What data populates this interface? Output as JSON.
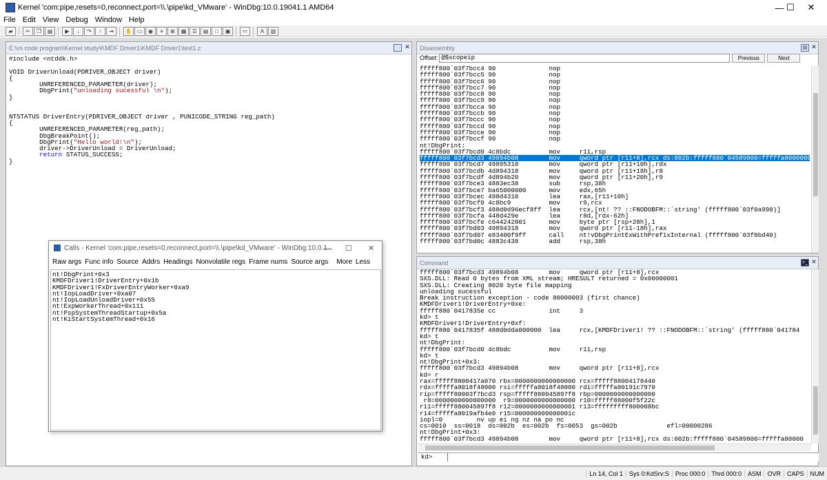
{
  "window": {
    "title": "Kernel 'com:pipe,resets=0,reconnect,port=\\\\.\\pipe\\kd_VMware' - WinDbg:10.0.19041.1 AMD64",
    "min_glyph": "—",
    "max_glyph": "☐",
    "close_glyph": "✕"
  },
  "menu": [
    "File",
    "Edit",
    "View",
    "Debug",
    "Window",
    "Help"
  ],
  "toolbar": [
    "open",
    "cut",
    "copy",
    "paste",
    "go",
    "step-into",
    "step-over",
    "step-out",
    "run-to-cursor",
    "break",
    "command",
    "watch",
    "locals",
    "registers",
    "memory",
    "call-stack",
    "disassembly",
    "scratch-pad",
    "processes",
    "source-mode",
    "font",
    "options"
  ],
  "source_pane": {
    "title": "E:\\vs code program\\Kernel study\\KMDF Driver1\\KMDF Driver1\\test1.c",
    "lines": [
      [
        {
          "t": "#include <ntddk.h>"
        }
      ],
      [
        {
          "t": ""
        }
      ],
      [
        {
          "t": "VOID DriverUnload(PDRIVER_OBJECT driver)"
        }
      ],
      [
        {
          "t": "{"
        }
      ],
      [
        {
          "t": "        UNREFERENCED_PARAMETER(driver);"
        }
      ],
      [
        {
          "t": "        DbgPrint("
        },
        {
          "t": "\"unloading sucessful \\n\"",
          "c": "str"
        },
        {
          "t": ");"
        }
      ],
      [
        {
          "t": "}"
        }
      ],
      [
        {
          "t": ""
        }
      ],
      [
        {
          "t": ""
        }
      ],
      [
        {
          "t": "NTSTATUS DriverEntry(PDRIVER_OBJECT driver , PUNICODE_STRING reg_path)"
        }
      ],
      [
        {
          "t": "{"
        }
      ],
      [
        {
          "t": "        UNREFERENCED_PARAMETER(reg_path);"
        }
      ],
      [
        {
          "t": "        DbgBreakPoint();"
        }
      ],
      [
        {
          "t": "        DbgPrint("
        },
        {
          "t": "\"Hello world!\\n\"",
          "c": "str"
        },
        {
          "t": ");"
        }
      ],
      [
        {
          "t": "        driver->DriverUnload = DriverUnload;"
        }
      ],
      [
        {
          "t": "        "
        },
        {
          "t": "return",
          "c": "kw"
        },
        {
          "t": " STATUS_SUCCESS;"
        }
      ],
      [
        {
          "t": "}"
        }
      ]
    ]
  },
  "disassembly_pane": {
    "title": "Disassembly",
    "offset_label": "Offset:",
    "offset_value": "@$scopeip",
    "previous_label": "Previous",
    "next_label": "Next",
    "highlight_index": 18,
    "lines": [
      "fffff800`03f7bcc4 90              nop",
      "fffff800`03f7bcc5 90              nop",
      "fffff800`03f7bcc6 90              nop",
      "fffff800`03f7bcc7 90              nop",
      "fffff800`03f7bcc8 90              nop",
      "fffff800`03f7bcc9 90              nop",
      "fffff800`03f7bcca 90              nop",
      "fffff800`03f7bccb 90              nop",
      "fffff800`03f7bccc 90              nop",
      "fffff800`03f7bccd 90              nop",
      "fffff800`03f7bcce 90              nop",
      "fffff800`03f7bccf 90              nop",
      "nt!DbgPrint:",
      "fffff800`03f7bcd0 4c8bdc          mov     r11,rsp",
      "fffff800`03f7bcd3 49894b08        mov     qword ptr [r11+8],rcx ds:002b:fffff880`04589800=fffffa8000000",
      "fffff800`03f7bcd7 49895310        mov     qword ptr [r11+10h],rdx",
      "fffff800`03f7bcdb 4d894318        mov     qword ptr [r11+18h],r8",
      "fffff800`03f7bcdf 4d894b20        mov     qword ptr [r11+20h],r9",
      "fffff800`03f7bce3 4883ec38        sub     rsp,38h",
      "fffff800`03f7bce7 ba65000000      mov     edx,65h",
      "fffff800`03f7bcec 498d4310        lea     rax,[r11+10h]",
      "fffff800`03f7bcf0 4c8bc9          mov     r9,rcx",
      "fffff800`03f7bcf3 488d0d96ecf8ff  lea     rcx,[nt! ?? ::FNODOBFM::`string' (fffff800`03f0a990)]",
      "fffff800`03f7bcfa 448d429e        lea     r8d,[rdx-62h]",
      "fffff800`03f7bcfe c644242801      mov     byte ptr [rsp+28h],1",
      "fffff800`03f7bd03 49894318        mov     qword ptr [r11-18h],rax",
      "fffff800`03f7bd07 e83400f9ff      call    nt!vDbgPrintExWithPrefixInternal (fffff800`03f0bd40)",
      "fffff800`03f7bd0c 4883c438        add     rsp,38h"
    ]
  },
  "command_pane": {
    "title": "Command",
    "prompt": "kd>",
    "lines": [
      "fffff800`03f7bcd3 49894b08        mov     qword ptr [r11+8],rcx",
      "SXS.DLL: Read 0 bytes from XML stream; HRESULT returned = 0x00000001",
      "SXS.DLL: Creating 8020 byte file mapping",
      "unloading sucessful",
      "Break instruction exception - code 80000003 (first chance)",
      "KMDFDriver1!DriverEntry+0xe:",
      "fffff880`0417835e cc              int     3",
      "kd> t",
      "KMDFDriver1!DriverEntry+0xf:",
      "fffff880`0417835f 488d0dda000000  lea     rcx,[KMDFDriver1! ?? ::FNODOBFM::`string' (fffff880`041784",
      "kd> t",
      "nt!DbgPrint:",
      "fffff800`03f7bcd0 4c8bdc          mov     r11,rsp",
      "kd> t",
      "nt!DbgPrint+0x3:",
      "fffff800`03f7bcd3 49894b08        mov     qword ptr [r11+8],rcx",
      "kd> r",
      "rax=fffff8800417a070 rbx=0000000000000000 rcx=fffff88004178440",
      "rdx=fffffa8018f48000 rsi=fffffa8018f48000 rdi=fffffa80191c7970",
      "rip=fffff80003f7bcd3 rsp=fffff880045897f8 rbp=0000000000000000",
      " r8=0000000000000000  r9=0000000000000000 r10=fffff88000f5f22c",
      "r11=fffff880045897f8 r12=0000000000000001 r13=fffffffff800008bc",
      "r14=fffffa8019afb4e0 r15=000000000000001c",
      "iopl=0         nv up ei ng nz na po nc",
      "cs=0010  ss=0018  ds=002b  es=002b  fs=0053  gs=002b             efl=00000286",
      "nt!DbgPrint+0x3:",
      "fffff800`03f7bcd3 49894b08        mov     qword ptr [r11+8],rcx ds:002b:fffff880`04589800=fffffa80000"
    ]
  },
  "calls_window": {
    "title": "Calls - Kernel 'com:pipe,resets=0,reconnect,port=\\\\.\\pipe\\kd_VMware' - WinDbg:10.0.1...",
    "buttons": [
      "Raw args",
      "Func info",
      "Source",
      "Addrs",
      "Headings",
      "Nonvolatile regs",
      "Frame nums",
      "Source args",
      "More",
      "Less"
    ],
    "frames": [
      "nt!DbgPrint+0x3",
      "KMDFDriver1!DriverEntry+0x1b",
      "KMDFDriver1!FxDriverEntryWorker+0xa9",
      "nt!IopLoadDriver+0xa07",
      "nt!IopLoadUnloadDriver+0x55",
      "nt!ExpWorkerThread+0x111",
      "nt!PspSystemThreadStartup+0x5a",
      "nt!KiStartSystemThread+0x16"
    ]
  },
  "status_bar": [
    "Ln 14, Col 1",
    "Sys 0:KdSrv:S",
    "Proc 000:0",
    "Thrd 000:0",
    "ASM",
    "OVR",
    "CAPS",
    "NUM"
  ]
}
